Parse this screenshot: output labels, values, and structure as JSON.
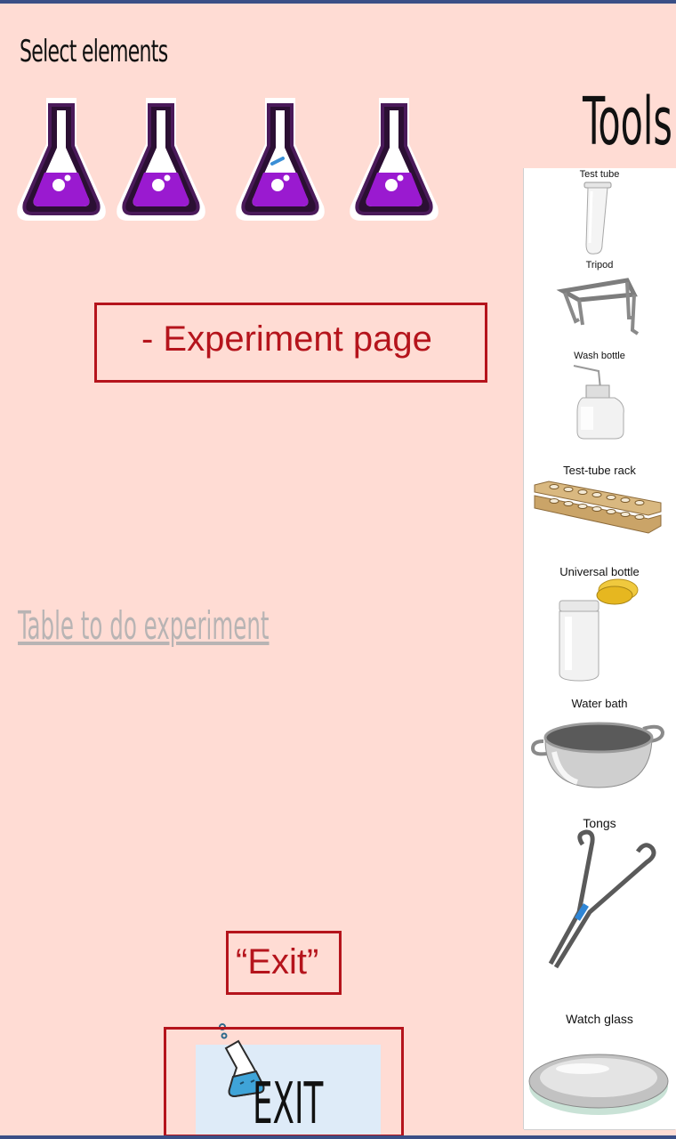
{
  "header": {
    "select_title": "Select elements",
    "tools_title": "Tools"
  },
  "flasks": [
    {
      "icon": "flask-icon",
      "liquid_color": "#9a1ad0"
    },
    {
      "icon": "flask-icon",
      "liquid_color": "#9a1ad0"
    },
    {
      "icon": "flask-icon",
      "liquid_color": "#9a1ad0"
    },
    {
      "icon": "flask-icon",
      "liquid_color": "#9a1ad0"
    }
  ],
  "annotations": {
    "experiment": "- Experiment page",
    "exit": "“Exit”"
  },
  "table_link": "Table to do experiment",
  "tools": [
    {
      "label": "Test tube",
      "icon": "test-tube-icon"
    },
    {
      "label": "Tripod",
      "icon": "tripod-icon"
    },
    {
      "label": "Wash bottle",
      "icon": "wash-bottle-icon"
    },
    {
      "label": "Test-tube rack",
      "icon": "test-tube-rack-icon"
    },
    {
      "label": "Universal bottle",
      "icon": "universal-bottle-icon"
    },
    {
      "label": "Water bath",
      "icon": "water-bath-icon"
    },
    {
      "label": "Tongs",
      "icon": "tongs-icon"
    },
    {
      "label": "Watch glass",
      "icon": "watch-glass-icon"
    }
  ],
  "exit_button": {
    "label": "EXIT",
    "icon": "flask-icon"
  },
  "colors": {
    "background": "#ffdcd4",
    "annotation_red": "#b5141c",
    "flask_purple": "#9a1ad0",
    "exit_bg": "#deebf8",
    "frame_border": "#3a4f86"
  }
}
